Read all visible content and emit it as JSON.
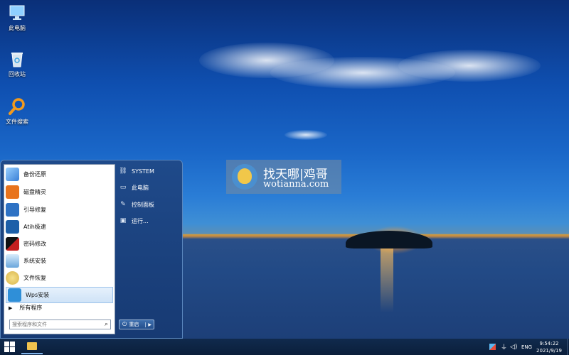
{
  "desktop": {
    "icons": [
      {
        "label": "此电脑",
        "icon": "computer-icon"
      },
      {
        "label": "回收站",
        "icon": "recycle-bin-icon"
      },
      {
        "label": "文件搜索",
        "icon": "magnifier-icon"
      }
    ]
  },
  "watermark": {
    "line1": "找天哪|鸡哥",
    "line2": "wotianna.com"
  },
  "start_menu": {
    "programs": [
      {
        "label": "备份还原",
        "icon": "backup-icon",
        "color": "#3a7fd6"
      },
      {
        "label": "磁盘精灵",
        "icon": "disk-genius-icon",
        "color": "#e8731c"
      },
      {
        "label": "引导修复",
        "icon": "wrench-icon",
        "color": "#2e72c4"
      },
      {
        "label": "Atih极速",
        "icon": "atih-icon",
        "color": "#1d5fa8"
      },
      {
        "label": "密码修改",
        "icon": "nt-password-icon",
        "color": "#c42020"
      },
      {
        "label": "系统安装",
        "icon": "install-icon",
        "color": "#6aa6dc"
      },
      {
        "label": "文件恢复",
        "icon": "file-recovery-icon",
        "color": "#d8b44a"
      },
      {
        "label": "Wps安装",
        "icon": "wps-icon",
        "color": "#2f8fd8"
      }
    ],
    "all_programs": "所有程序",
    "search_placeholder": "搜索程序和文件",
    "right_items": [
      {
        "label": "SYSTEM",
        "icon": "user-icon"
      },
      {
        "label": "此电脑",
        "icon": "computer-icon"
      },
      {
        "label": "控制面板",
        "icon": "control-panel-icon"
      },
      {
        "label": "运行...",
        "icon": "run-icon"
      }
    ],
    "shutdown_label": "重启"
  },
  "taskbar": {
    "tray_lang": "ENG",
    "clock_time": "9:54:22",
    "clock_date": "2021/9/19"
  }
}
